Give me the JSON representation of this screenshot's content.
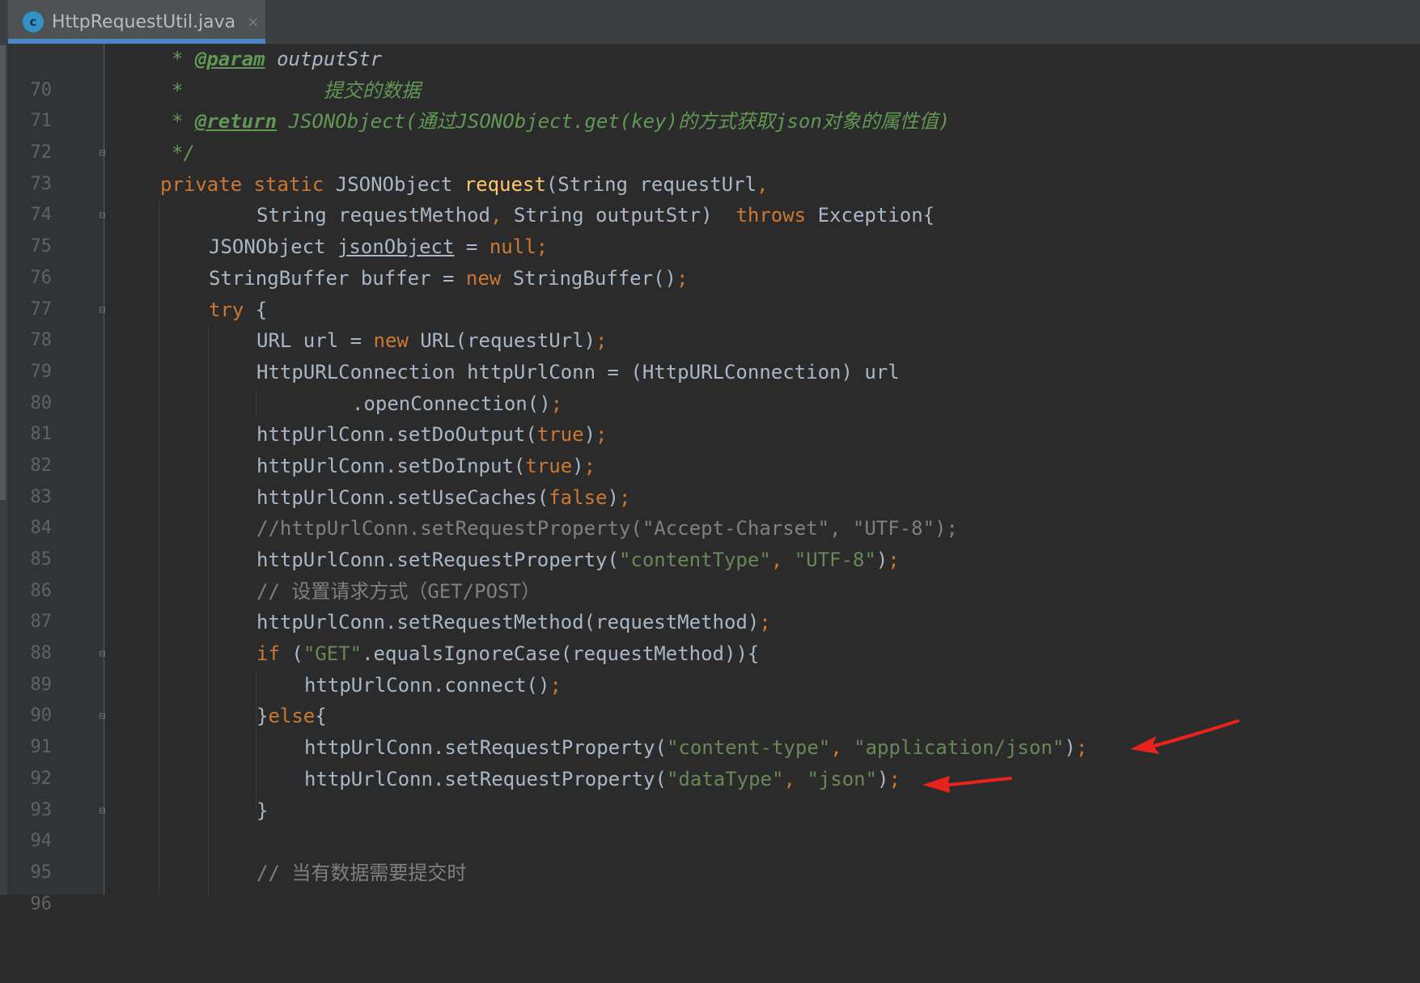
{
  "tab": {
    "icon_letter": "c",
    "title": "HttpRequestUtil.java",
    "close": "×"
  },
  "lines": [
    {
      "n": "70",
      "t0": "* ",
      "t1": "@param",
      "t2": " ",
      "t3": "outputStr"
    },
    {
      "n": "71",
      "t0": "*            提交的数据"
    },
    {
      "n": "72",
      "t0": "* ",
      "t1": "@return",
      "t2": " JSONObject(通过JSONObject.get(key)的方式获取json对象的属性值)"
    },
    {
      "n": "73",
      "t0": "*/"
    },
    {
      "n": "74",
      "t0": "private static ",
      "t1": "JSONObject ",
      "t2": "request",
      "t3": "(String requestUrl",
      "t4": ","
    },
    {
      "n": "75",
      "t0": "String requestMethod",
      "t1": ", ",
      "t2": "String outputStr)  ",
      "t3": "throws ",
      "t4": "Exception{"
    },
    {
      "n": "76",
      "t0": "JSONObject ",
      "t1": "jsonObject",
      "t2": " = ",
      "t3": "null;"
    },
    {
      "n": "77",
      "t0": "StringBuffer buffer = ",
      "t1": "new ",
      "t2": "StringBuffer()",
      "t3": ";"
    },
    {
      "n": "78",
      "t0": "try ",
      "t1": "{"
    },
    {
      "n": "79",
      "t0": "URL url = ",
      "t1": "new ",
      "t2": "URL(requestUrl)",
      "t3": ";"
    },
    {
      "n": "80",
      "t0": "HttpURLConnection httpUrlConn = (HttpURLConnection) url"
    },
    {
      "n": "81",
      "t0": ".openConnection()",
      "t1": ";"
    },
    {
      "n": "82",
      "t0": "httpUrlConn.setDoOutput(",
      "t1": "true",
      "t2": ")",
      "t3": ";"
    },
    {
      "n": "83",
      "t0": "httpUrlConn.setDoInput(",
      "t1": "true",
      "t2": ")",
      "t3": ";"
    },
    {
      "n": "84",
      "t0": "httpUrlConn.setUseCaches(",
      "t1": "false",
      "t2": ")",
      "t3": ";"
    },
    {
      "n": "85",
      "t0": "//httpUrlConn.setRequestProperty(\"Accept-Charset\", \"UTF-8\");"
    },
    {
      "n": "86",
      "t0": "httpUrlConn.setRequestProperty(",
      "t1": "\"contentType\"",
      "t2": ", ",
      "t3": "\"UTF-8\"",
      "t4": ")",
      "t5": ";"
    },
    {
      "n": "87",
      "t0": "// 设置请求方式（GET/POST）"
    },
    {
      "n": "88",
      "t0": "httpUrlConn.setRequestMethod(requestMethod)",
      "t1": ";"
    },
    {
      "n": "89",
      "t0": "if ",
      "t1": "(",
      "t2": "\"GET\"",
      "t3": ".equalsIgnoreCase(requestMethod)){"
    },
    {
      "n": "90",
      "t0": "httpUrlConn.connect()",
      "t1": ";"
    },
    {
      "n": "91",
      "t0": "}",
      "t1": "else",
      "t2": "{"
    },
    {
      "n": "92",
      "t0": "httpUrlConn.setRequestProperty(",
      "t1": "\"content-type\"",
      "t2": ", ",
      "t3": "\"application/json\"",
      "t4": ")",
      "t5": ";"
    },
    {
      "n": "93",
      "t0": "httpUrlConn.setRequestProperty(",
      "t1": "\"dataType\"",
      "t2": ", ",
      "t3": "\"json\"",
      "t4": ")",
      "t5": ";"
    },
    {
      "n": "94",
      "t0": "}"
    },
    {
      "n": "95"
    },
    {
      "n": "96",
      "t0": "// 当有数据需要提交时"
    }
  ],
  "colors": {
    "editor_bg": "#2b2b2b",
    "keyword": "#cc7832",
    "text": "#a9b7c6",
    "method_decl": "#ffc66d",
    "string": "#6a8759",
    "comment": "#808080",
    "doc_comment": "#629755",
    "annotation_arrow": "#e8231b"
  }
}
